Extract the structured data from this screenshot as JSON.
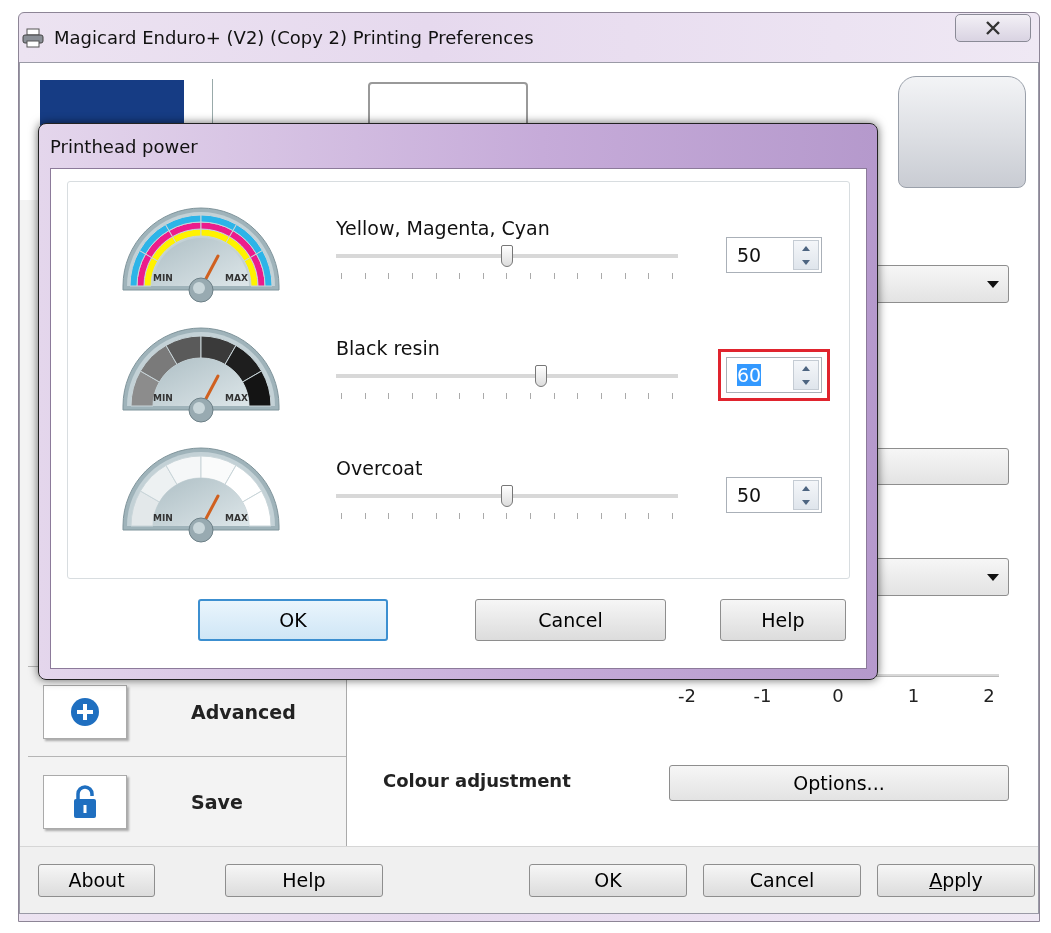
{
  "window": {
    "title": "Magicard Enduro+ (V2) (Copy 2) Printing Preferences"
  },
  "sidebar": {
    "items": [
      {
        "label": "Advanced",
        "kind": "plus"
      },
      {
        "label": "Save",
        "kind": "lock"
      }
    ]
  },
  "settings": [
    {
      "kind": "dropdown"
    },
    {
      "kind": "button"
    },
    {
      "kind": "dropdown"
    },
    {
      "kind": "scale",
      "ticks": [
        "-2",
        "-1",
        "0",
        "1",
        "2"
      ]
    },
    {
      "kind": "option_row",
      "label": "Colour adjustment",
      "button": "Options..."
    }
  ],
  "footer": {
    "left_buttons": [
      {
        "label": "About"
      },
      {
        "label": "Help"
      }
    ],
    "right_buttons": [
      {
        "label": "OK",
        "mnemonic": false
      },
      {
        "label": "Cancel",
        "mnemonic": false
      },
      {
        "label": "Apply",
        "mnemonic": true
      }
    ]
  },
  "dialog": {
    "title": "Printhead power",
    "channels": [
      {
        "name": "Yellow, Magenta, Cyan",
        "kind": "cmy",
        "min_label": "MIN",
        "max_label": "MAX",
        "level": 0.5,
        "value": "50",
        "highlighted": false
      },
      {
        "name": "Black resin",
        "kind": "black",
        "min_label": "MIN",
        "max_label": "MAX",
        "level": 0.6,
        "value": "60",
        "highlighted": true
      },
      {
        "name": "Overcoat",
        "kind": "overcoat",
        "min_label": "MIN",
        "max_label": "MAX",
        "level": 0.5,
        "value": "50",
        "highlighted": false
      }
    ],
    "buttons": [
      {
        "label": "OK",
        "default": true
      },
      {
        "label": "Cancel",
        "default": false
      },
      {
        "label": "Help",
        "default": false
      }
    ]
  }
}
